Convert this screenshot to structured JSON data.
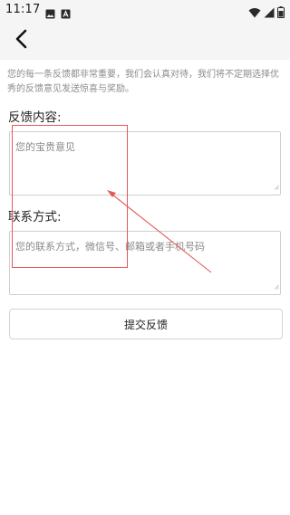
{
  "status_bar": {
    "time": "11:17",
    "left_icons": [
      "image-icon",
      "a-app-icon"
    ],
    "right_icons": [
      "wifi-icon",
      "signal-icon",
      "battery-icon"
    ]
  },
  "app_bar": {
    "back_icon": "back-chevron-icon"
  },
  "intro": {
    "text": "您的每一条反馈都非常重要，我们会认真对待，我们将不定期选择优秀的反馈意见发送惊喜与奖励。"
  },
  "feedback": {
    "label": "反馈内容:",
    "placeholder": "您的宝贵意见"
  },
  "contact": {
    "label": "联系方式:",
    "placeholder": "您的联系方式，微信号、邮箱或者手机号码"
  },
  "submit": {
    "label": "提交反馈"
  },
  "annotation": {
    "color": "#e35a5a"
  },
  "colors": {
    "background": "#ffffff",
    "bar_background": "#f5f5f5",
    "muted_text": "#8c8c8c",
    "border": "#cfcfcf"
  }
}
